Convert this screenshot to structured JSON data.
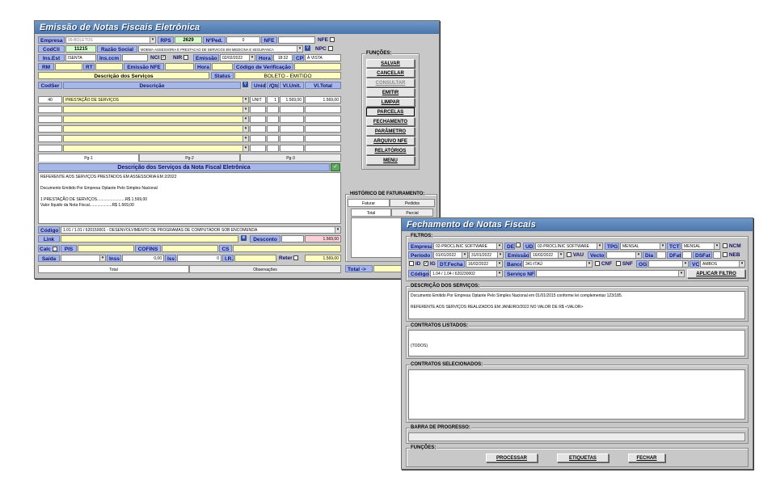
{
  "w1": {
    "title": "Emissão de Notas Fiscais Eletrônica",
    "empresa_lbl": "Empresa",
    "empresa_val": "99-BOLETOS",
    "rps_lbl": "RPS",
    "rps_val": "2629",
    "nped_lbl": "NºPed.",
    "nped_val": "0",
    "nfe_lbl": "NFE",
    "nfe_chk_lbl": "NFE",
    "codcli_lbl": "CodCli",
    "codcli_val": "11215",
    "razao_lbl": "Razão Social",
    "razao_val": "MOEMA-ASSESSORIA E PRESTACAO DE SERVICOS EM MEDICINA E SEGURANCA",
    "npc_lbl": "NPC",
    "insest_lbl": "Ins.Est",
    "insest_val": "ISENTA",
    "insccm_lbl": "Ins.ccm",
    "nci_lbl": "NCI",
    "nir_lbl": "NIR",
    "emissao_lbl": "Emissão",
    "emissao_val": "02/02/2022",
    "hora_lbl": "Hora",
    "hora_val": "18:32",
    "cp_lbl": "CP",
    "cp_val": "À VISTA",
    "rm_lbl": "RM",
    "rt_lbl": "RT",
    "emissao_nfe_lbl": "Emissão NFE",
    "hora2_lbl": "Hora",
    "codverif_lbl": "Código de Verificação",
    "desc_serv_hdr": "Descrição dos Serviços",
    "status_lbl": "Status",
    "status_val": "BOLETO - EMITIDO",
    "grid_headers": [
      "CodSer",
      "Descrição",
      "Unid.",
      "/Qtd",
      "Vl.Unit.",
      "Vl.Total"
    ],
    "grid_row1": {
      "cod": "40",
      "desc": "PRESTAÇÃO DE SERVIÇOS",
      "unid": "UNIT",
      "qtd": "1",
      "vunit": "1.569,00",
      "vtotal": "1.569,00"
    },
    "pages": [
      "Pg-1",
      "Pg-2",
      "Pg-3"
    ],
    "nf_desc_hdr": "Descrição dos Serviços da Nota Fiscal Eletrônica",
    "nf_desc_text": "REFERENTE AOS SERVIÇOS PRESTADOS EM ASSESSORIA EM 2/2022\n\nDocumento Emitido Por Empresa Optante Pelo Simples Nacional\n\n1 PRESTAÇÃO DE SERVIÇOS.........................R$ 1.569,00\nValor líquido da Nota Fiscal....................R$ 1.569,00",
    "codigo_lbl": "Código",
    "codigo_val": "1.01 / 1.01 / 620150001 - DESENVOLVIMENTO DE PROGRAMAS DE COMPUTADOR SOB ENCOMENDA",
    "link_lbl": "Link",
    "desconto_lbl": "Desconto",
    "desconto_val": "1.569,00",
    "calc_lbl": "Calc",
    "pis_lbl": "PIS",
    "cofins_lbl": "COFINS",
    "cs_lbl": "CS",
    "saida_lbl": "Saída",
    "inss_lbl": "Inss",
    "inss_val": "0,00",
    "iss_lbl": "Iss",
    "iss_val": "0",
    "ir_lbl": "I.R.",
    "reter_lbl": "Reter",
    "reter_val": "1.569,00",
    "total_lbl": "Total",
    "obs_lbl": "Observações",
    "funcoes_lbl": "FUNÇÕES:",
    "buttons": [
      "SALVAR",
      "CANCELAR",
      "CONSULTAR",
      "EMITIR",
      "LIMPAR",
      "PARCELAS",
      "FECHAMENTO",
      "PARÂMETRO",
      "ARQUIVO NFE",
      "RELATÓRIOS",
      "MENU"
    ],
    "hist_lbl": "HISTÓRICO DE FATURAMENTO:",
    "hist_tabs": [
      "Faturar",
      "Pedidos"
    ],
    "hist_subtabs": [
      "Total",
      "Parcial"
    ],
    "total_arrow": "Total ->"
  },
  "w2": {
    "title": "Fechamento de Notas Fiscais",
    "filtros_lbl": "FILTROS:",
    "empresa_lbl": "Empresa",
    "empresa_val": "02-PROCLINIC SOFTWARE",
    "de_lbl": "DE",
    "ud_lbl": "UD",
    "ud_val": "02-PROCLINIC SOFTWARE",
    "tpg_lbl": "TPG",
    "tpg_val": "MENSAL",
    "tct_lbl": "TCT",
    "tct_val": "MENSAL",
    "ncm_lbl": "NCM",
    "periodo_lbl": "Período",
    "periodo_de": "01/01/2022",
    "periodo_ate": "31/01/2022",
    "emissao_lbl": "Emissão",
    "emissao_val": "16/02/2022",
    "vau_lbl": "VAU",
    "vecto_lbl": "Vecto",
    "dia_lbl": "Dia",
    "dfat_lbl": "DFat",
    "dsfat_lbl": "DSFat",
    "neb_lbl": "NEB",
    "id_lbl": "ID",
    "ig_lbl": "IG",
    "dtfecha_lbl": "DT.Fecha",
    "dtfecha_val": "16/02/2022",
    "banco_lbl": "Banco",
    "banco_val": "341-ITAÚ",
    "cnf_lbl": "CNF",
    "snf_lbl": "SNF",
    "og_lbl": "OG",
    "vc_lbl": "VC",
    "vc_val": "AMBOS",
    "codigo_lbl": "Código",
    "codigo_val": "1.04 / 1.04 / 620230002",
    "servico_lbl": "Serviço NF",
    "aplicar_btn": "APLICAR FILTRO",
    "desc_lbl": "DESCRIÇÃO DOS SERVIÇOS:",
    "desc_text": "Documento Emitido Por Empresa Optante Pelo Simples Nacional em 01/01/2015 conforme lei complementar 123/185.\n\nREFERENTE AOS SERVIÇOS REALIZADOS EM JANEIRO/2022 NO VALOR DE R$ <VALOR>",
    "contratos_lbl": "CONTRATOS LISTADOS:",
    "contratos_item": "(TODOS)",
    "selecionados_lbl": "CONTRATOS SELECIONADOS:",
    "barra_lbl": "BARRA DE PROGRESSO:",
    "progress": 0,
    "funcoes_lbl": "FUNÇÕES:",
    "btn_processar": "PROCESSAR",
    "btn_etiquetas": "ETIQUETAS",
    "btn_fechar": "FECHAR"
  }
}
